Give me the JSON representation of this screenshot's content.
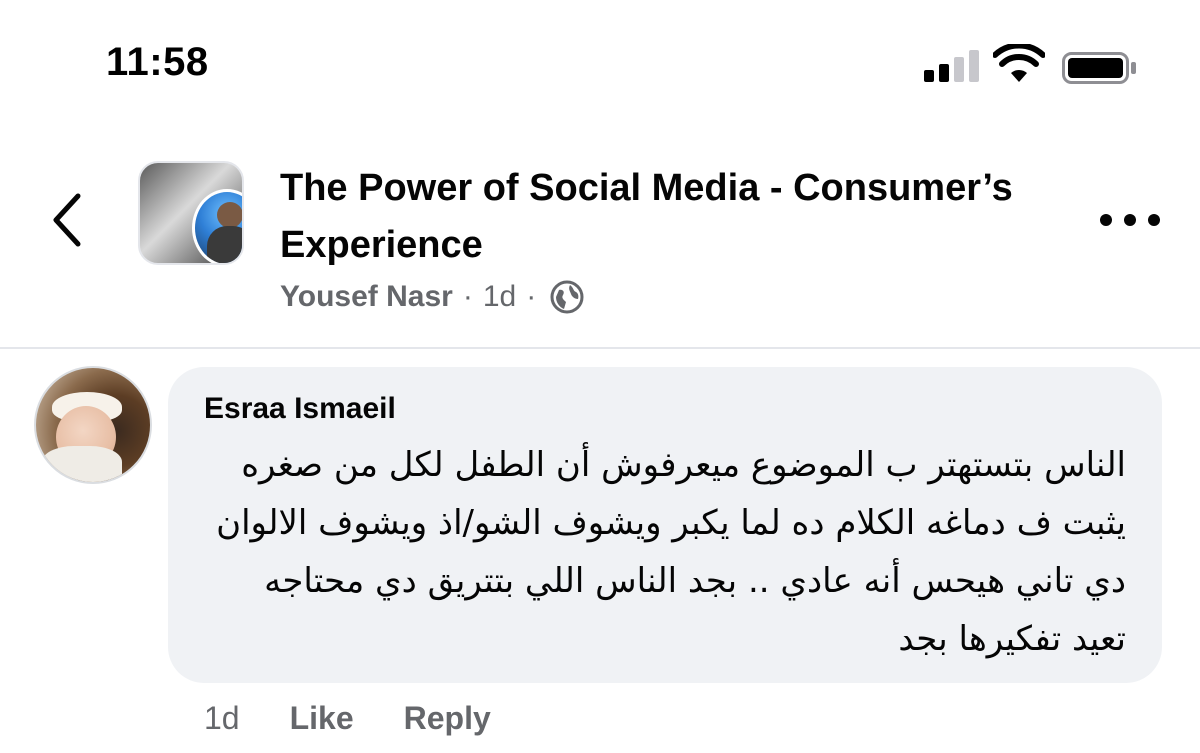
{
  "status_bar": {
    "time": "11:58",
    "signal_icon": "cellular-signal-icon",
    "wifi_icon": "wifi-icon",
    "battery_icon": "battery-icon"
  },
  "header": {
    "back_icon": "chevron-left-icon",
    "title": "The Power of Social Media - Consumer’s Experience",
    "author": "Yousef Nasr",
    "age": "1d",
    "separator": "·",
    "privacy_icon": "globe-icon",
    "more_icon": "more-horizontal-icon"
  },
  "comment": {
    "author": "Esraa Ismaeil",
    "text": "الناس بتستهتر ب الموضوع ميعرفوش أن الطفل لكل من صغره يثبت ف دماغه الكلام ده لما يكبر ويشوف الشو/اذ ويشوف الالوان دي تاني هيحس أنه عادي .. بجد الناس اللي بتتريق دي محتاجه تعيد تفكيرها بجد",
    "age": "1d",
    "like_label": "Like",
    "reply_label": "Reply"
  },
  "colors": {
    "text_primary": "#050505",
    "text_secondary": "#65676b",
    "bubble_bg": "#f0f2f5",
    "divider": "#e4e6eb"
  }
}
